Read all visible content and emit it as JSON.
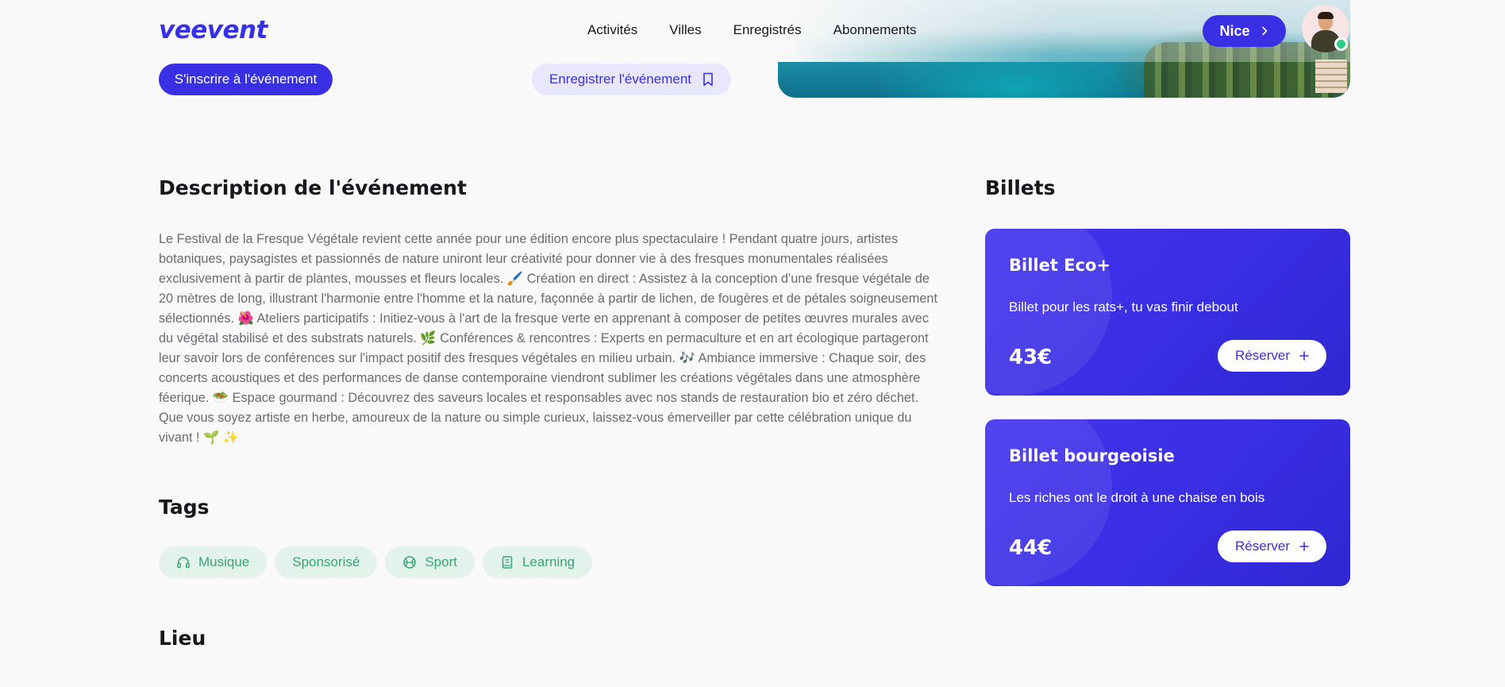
{
  "header": {
    "logo": "veevent",
    "nav": [
      "Activités",
      "Villes",
      "Enregistrés",
      "Abonnements"
    ],
    "city_button": "Nice",
    "avatar_status": "online"
  },
  "actions": {
    "register_label": "S'inscrire à l'événement",
    "save_label": "Enregistrer l'événement"
  },
  "description": {
    "heading": "Description de l'événement",
    "text": "Le Festival de la Fresque Végétale revient cette année pour une édition encore plus spectaculaire ! Pendant quatre jours, artistes botaniques, paysagistes et passionnés de nature uniront leur créativité pour donner vie à des fresques monumentales réalisées exclusivement à partir de plantes, mousses et fleurs locales. 🖌️ Création en direct : Assistez à la conception d'une fresque végétale de 20 mètres de long, illustrant l'harmonie entre l'homme et la nature, façonnée à partir de lichen, de fougères et de pétales soigneusement sélectionnés. 🌺 Ateliers participatifs : Initiez-vous à l'art de la fresque verte en apprenant à composer de petites œuvres murales avec du végétal stabilisé et des substrats naturels. 🌿 Conférences & rencontres : Experts en permaculture et en art écologique partageront leur savoir lors de conférences sur l'impact positif des fresques végétales en milieu urbain. 🎶 Ambiance immersive : Chaque soir, des concerts acoustiques et des performances de danse contemporaine viendront sublimer les créations végétales dans une atmosphère féerique. 🥗 Espace gourmand : Découvrez des saveurs locales et responsables avec nos stands de restauration bio et zéro déchet. Que vous soyez artiste en herbe, amoureux de la nature ou simple curieux, laissez-vous émerveiller par cette célébration unique du vivant ! 🌱 ✨"
  },
  "tags": {
    "heading": "Tags",
    "items": [
      {
        "label": "Musique",
        "icon": "headphones-icon"
      },
      {
        "label": "Sponsorisé",
        "icon": ""
      },
      {
        "label": "Sport",
        "icon": "ball-icon"
      },
      {
        "label": "Learning",
        "icon": "book-icon"
      }
    ]
  },
  "location": {
    "heading": "Lieu"
  },
  "tickets": {
    "heading": "Billets",
    "items": [
      {
        "name": "Billet Eco+",
        "description": "Billet pour les rats+, tu vas finir debout",
        "price": "43€",
        "button": "Réserver"
      },
      {
        "name": "Billet bourgeoisie",
        "description": "Les riches ont le droit à une chaise en bois",
        "price": "44€",
        "button": "Réserver"
      }
    ]
  },
  "colors": {
    "primary": "#3930e6",
    "tag_bg": "#e4f2ec",
    "tag_text": "#3aa57a",
    "online": "#2ecc84"
  }
}
